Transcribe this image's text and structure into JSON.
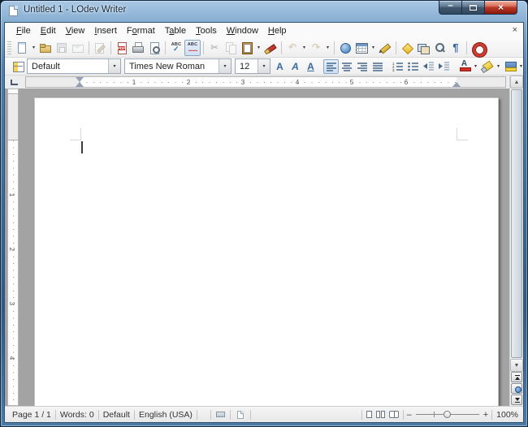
{
  "window": {
    "title": "Untitled 1 - LOdev Writer",
    "minimize_glyph": "–",
    "close_glyph": "×"
  },
  "menubar": {
    "items": [
      {
        "pre": "",
        "accel": "F",
        "post": "ile"
      },
      {
        "pre": "",
        "accel": "E",
        "post": "dit"
      },
      {
        "pre": "",
        "accel": "V",
        "post": "iew"
      },
      {
        "pre": "",
        "accel": "I",
        "post": "nsert"
      },
      {
        "pre": "F",
        "accel": "o",
        "post": "rmat"
      },
      {
        "pre": "T",
        "accel": "a",
        "post": "ble"
      },
      {
        "pre": "",
        "accel": "T",
        "post": "ools"
      },
      {
        "pre": "",
        "accel": "W",
        "post": "indow"
      },
      {
        "pre": "",
        "accel": "H",
        "post": "elp"
      }
    ],
    "close_doc_glyph": "×"
  },
  "icons": {
    "caret": "▾",
    "cut": "✂",
    "undo": "↶",
    "redo": "↷",
    "pilcrow": "¶",
    "abc": "ABC",
    "check": "✓",
    "squiggle": "~~~",
    "pdf_label": "PDF",
    "bold": "A",
    "italic": "A",
    "underline": "A",
    "font_color_letter": "A",
    "scroll_up": "▲",
    "scroll_down": "▼"
  },
  "toolbar_standard": {
    "icon_names": [
      "new-document",
      "open",
      "save",
      "send-email",
      "edit-mode",
      "export-pdf",
      "print",
      "print-preview",
      "spelling",
      "auto-spellcheck",
      "cut",
      "copy",
      "paste",
      "clone-formatting",
      "undo",
      "redo",
      "hyperlink",
      "insert-table",
      "draw-functions",
      "navigator",
      "gallery",
      "zoom",
      "formatting-marks",
      "help"
    ],
    "pressed": [
      "auto-spellcheck"
    ],
    "disabled": [
      "save",
      "send-email",
      "edit-mode",
      "cut",
      "copy",
      "undo",
      "redo"
    ]
  },
  "toolbar_formatting": {
    "icon_names": [
      "styles",
      "bold",
      "italic",
      "underline",
      "align-left",
      "align-center",
      "align-right",
      "justify",
      "numbered-list",
      "bullet-list",
      "decrease-indent",
      "increase-indent",
      "font-color",
      "highlighting",
      "background-color"
    ],
    "pressed": [
      "align-left"
    ],
    "paragraph_style": "Default",
    "font_name": "Times New Roman",
    "font_size": "12"
  },
  "ruler": {
    "horizontal_numbers": [
      "1",
      "2",
      "3",
      "4",
      "5",
      "6"
    ],
    "vertical_numbers": [
      "1",
      "2",
      "3",
      "4"
    ]
  },
  "statusbar": {
    "page": "Page 1 / 1",
    "words": "Words: 0",
    "style": "Default",
    "language": "English (USA)",
    "zoom_minus": "–",
    "zoom_plus": "+",
    "zoom_value": "100%"
  },
  "colors": {
    "titlebar_blue": "#3d6b99",
    "close_red": "#bc3b28",
    "accent_blue": "#39699f",
    "highlight_yellow": "#f2d544",
    "pdf_red": "#c43b2e",
    "canvas_gray": "#a3a3a3"
  }
}
